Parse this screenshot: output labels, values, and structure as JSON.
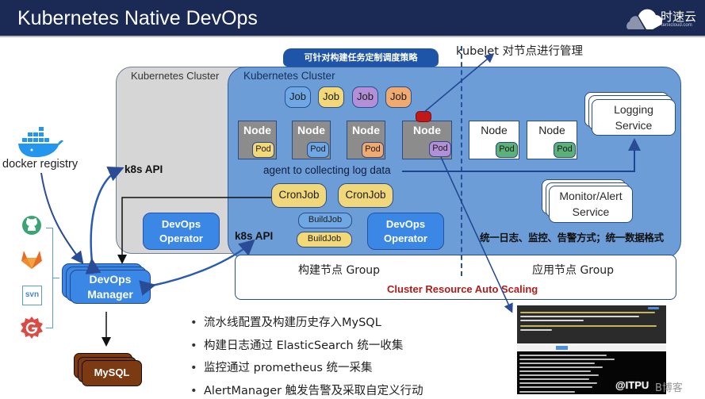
{
  "header": {
    "title": "Kubernetes Native DevOps",
    "logo": {
      "icon": "cloud-logo-icon",
      "name_cn": "时速云",
      "domain": "tenxcloud.com"
    }
  },
  "top_notes": {
    "strategy_label": "可针对构建任务定制调度策略",
    "kubelet_note": "kubelet 对节点进行管理"
  },
  "clusters": {
    "left": {
      "label": "Kubernetes Cluster",
      "api_label": "k8s API",
      "operator_label_1": "DevOps",
      "operator_label_2": "Operator"
    },
    "right": {
      "label": "Kubernetes Cluster",
      "api_label": "k8s API",
      "operator_label_1": "DevOps",
      "operator_label_2": "Operator"
    }
  },
  "jobs": [
    {
      "label": "Job",
      "color": "#6ea7e4"
    },
    {
      "label": "Job",
      "color": "#f2d877"
    },
    {
      "label": "Job",
      "color": "#b28fd6"
    },
    {
      "label": "Job",
      "color": "#f0a96e"
    }
  ],
  "build_nodes": [
    {
      "label": "Node",
      "pod": "Pod",
      "pod_color": "#f2d877"
    },
    {
      "label": "Node",
      "pod": "Pod",
      "pod_color": "#6ea7e4"
    },
    {
      "label": "Node",
      "pod": "Pod",
      "pod_color": "#f0a96e"
    },
    {
      "label": "Node",
      "pod": "Pod",
      "pod_color": "#b28fd6"
    }
  ],
  "app_nodes": [
    {
      "label": "Node",
      "pod": "Pod",
      "pod_color": "#5cb07a"
    },
    {
      "label": "Node",
      "pod": "Pod",
      "pod_color": "#5cb07a"
    }
  ],
  "agent_text": "agent to collecting log data",
  "cronjobs": [
    "CronJob",
    "CronJob"
  ],
  "buildjobs": [
    {
      "label": "BuildJob",
      "color": "#6ea7e4"
    },
    {
      "label": "BuildJob",
      "color": "#f2d877"
    }
  ],
  "services": {
    "logging": {
      "line1": "Logging",
      "line2": "Service"
    },
    "monitor": {
      "line1": "Monitor/Alert",
      "line2": "Service"
    }
  },
  "unified_text": "统一日志、监控、告警方式；统一数据格式",
  "groups": {
    "build": "构建节点  Group",
    "app": "应用节点 Group",
    "autoscale": "Cluster Resource Auto Scaling"
  },
  "left_side": {
    "docker_label": "docker registry",
    "docker_icon": "docker-whale-icon",
    "vcs_icons": [
      "github-icon",
      "gitlab-icon",
      "svn-icon",
      "gogs-icon"
    ],
    "svn_text": "svn",
    "manager_line1": "DevOps",
    "manager_line2": "Manager",
    "mysql_label": "MySQL"
  },
  "bullets": [
    "流水线配置及构建历史存入MySQL",
    "构建日志通过 ElasticSearch 统一收集",
    "监控通过 prometheus 统一采集",
    "AlertManager 触发告警及采取自定义行动"
  ],
  "watermark": {
    "main": "@ITPU",
    "suffix": "B博客"
  },
  "colors": {
    "header_bg": "#1b2a55",
    "cluster_blue": "#6c9dd6",
    "cluster_grey": "#d6d6d6",
    "operator_blue": "#3a87e6",
    "accent_red": "#b01b1b",
    "mysql_brown": "#7c3a12"
  }
}
